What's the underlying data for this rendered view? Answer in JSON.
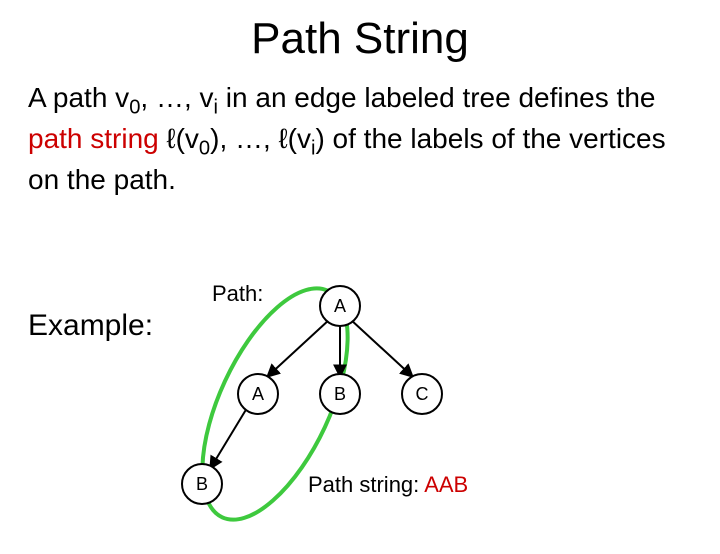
{
  "title": "Path String",
  "definition": {
    "prefix": "A path v",
    "sub0": "0",
    "mid1": ", …, v",
    "subi": "i",
    "mid2": " in an edge labeled tree defines the ",
    "term": "path string",
    "mid3": " ℓ(v",
    "sub0b": "0",
    "mid4": "), …, ℓ(v",
    "subib": "i",
    "tail": ") of the labels of the vertices on the path."
  },
  "example_label": "Example:",
  "path_label": "Path:",
  "tree": {
    "root": "A",
    "childA": "A",
    "childB": "B",
    "childC": "C",
    "leafB": "B"
  },
  "pathstring": {
    "label": "Path string: ",
    "value": "AAB"
  }
}
